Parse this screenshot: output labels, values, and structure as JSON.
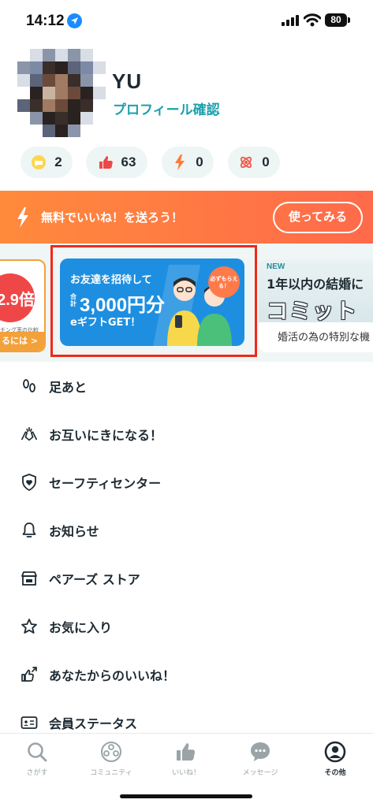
{
  "status_bar": {
    "time": "14:12",
    "battery": "80"
  },
  "profile": {
    "name": "YU",
    "link_label": "プロフィール確認"
  },
  "stats": [
    {
      "icon": "chat-bubble-icon",
      "value": "2"
    },
    {
      "icon": "thumbs-up-icon",
      "value": "63"
    },
    {
      "icon": "lightning-icon",
      "value": "0"
    },
    {
      "icon": "atom-icon",
      "value": "0"
    }
  ],
  "promo": {
    "text": "無料でいいね！を送ろう！",
    "button_label": "使ってみる"
  },
  "carousel": {
    "left": {
      "badge": "2.9倍",
      "small": "チング率の比較",
      "bar": "るには >"
    },
    "middle": {
      "line1": "お友達を招待して",
      "small": "合計",
      "amount": "3,000円分",
      "line3": "eギフトGET！",
      "sticker": "必ずもらえる！"
    },
    "right": {
      "new": "NEW",
      "line1": "1年以内の結婚に",
      "line2": "コミット",
      "line3": "婚活の為の特別な機"
    }
  },
  "menu": [
    {
      "label": "足あと",
      "icon": "footprints-icon"
    },
    {
      "label": "お互いにきになる！",
      "icon": "handshake-icon"
    },
    {
      "label": "セーフティセンター",
      "icon": "shield-heart-icon"
    },
    {
      "label": "お知らせ",
      "icon": "bell-icon"
    },
    {
      "label": "ペアーズ ストア",
      "icon": "store-icon"
    },
    {
      "label": "お気に入り",
      "icon": "star-icon"
    },
    {
      "label": "あなたからのいいね！",
      "icon": "thumbs-up-arrow-icon"
    },
    {
      "label": "会員ステータス",
      "icon": "id-card-icon"
    }
  ],
  "tabs": [
    {
      "label": "さがす",
      "icon": "search-icon"
    },
    {
      "label": "コミュニティ",
      "icon": "community-icon"
    },
    {
      "label": "いいね！",
      "icon": "thumbs-up-icon"
    },
    {
      "label": "メッセージ",
      "icon": "message-icon"
    },
    {
      "label": "その他",
      "icon": "profile-icon"
    }
  ],
  "colors": {
    "accent": "#1aa1ac",
    "promo": "#ff7a45",
    "highlight": "#ee2a1a",
    "tab_inactive": "#9aa4a8"
  }
}
